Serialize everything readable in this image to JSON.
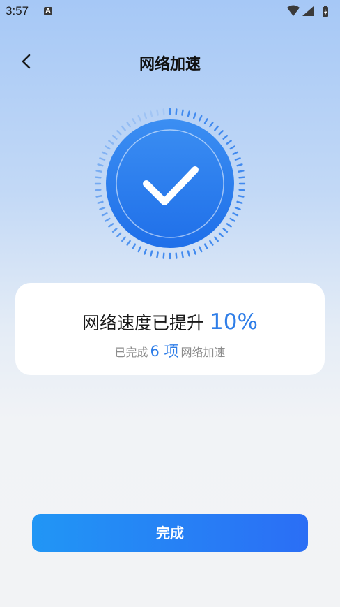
{
  "status_bar": {
    "time": "3:57",
    "notification_icon": "a-box-icon",
    "icons": [
      "wifi-icon",
      "signal-icon",
      "battery-charging-icon"
    ]
  },
  "nav": {
    "back_icon": "chevron-left-icon",
    "title": "网络加速"
  },
  "hero": {
    "icon": "checkmark-icon",
    "primary_color": "#2f7ee8"
  },
  "result_card": {
    "title_prefix": "网络速度已提升",
    "percent": "10%",
    "sub_prefix": "已完成",
    "count": "6 项",
    "sub_suffix": "网络加速"
  },
  "done_button": {
    "label": "完成"
  },
  "colors": {
    "accent": "#2f7ee8",
    "button_start": "#2196f5",
    "button_end": "#2b6ef5"
  }
}
